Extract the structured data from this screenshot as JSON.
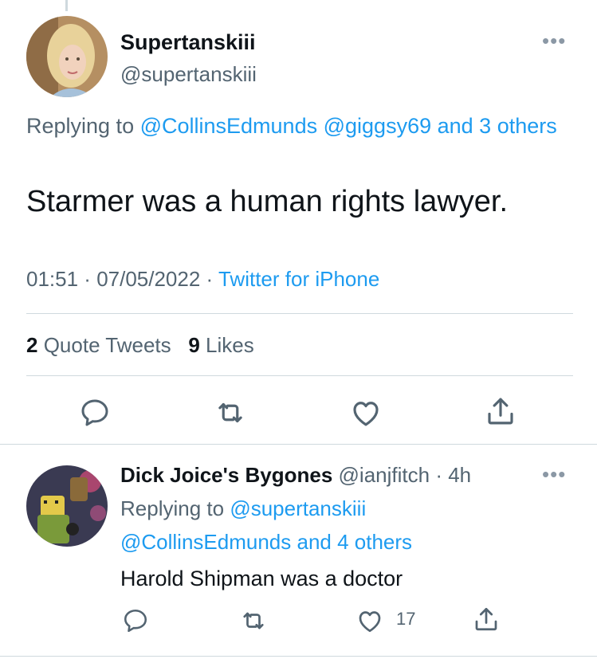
{
  "tweet": {
    "display_name": "Supertanskiii",
    "handle": "@supertanskiii",
    "replying_label": "Replying to ",
    "replying_users": [
      "@CollinsEdmunds",
      "@giggsy69"
    ],
    "replying_others": "and 3 others",
    "text": "Starmer was a human rights lawyer.",
    "time": "01:51",
    "date": "07/05/2022",
    "source": "Twitter for iPhone",
    "quote_count": "2",
    "quote_label": "Quote Tweets",
    "like_count": "9",
    "like_label": "Likes"
  },
  "reply": {
    "display_name": "Dick Joice's Bygones",
    "handle": "@ianjfitch",
    "age": "4h",
    "replying_label": "Replying to ",
    "replying_users": [
      "@supertanskiii",
      "@CollinsEdmunds"
    ],
    "replying_others": "and 4 others",
    "text": "Harold Shipman was a doctor",
    "like_count": "17"
  },
  "icons": [
    "reply-icon",
    "retweet-icon",
    "like-icon",
    "share-icon",
    "more-icon"
  ],
  "colors": {
    "link": "#1d9bf0",
    "secondary_text": "#536471",
    "primary_text": "#0f1419",
    "divider": "#cfd9de"
  }
}
